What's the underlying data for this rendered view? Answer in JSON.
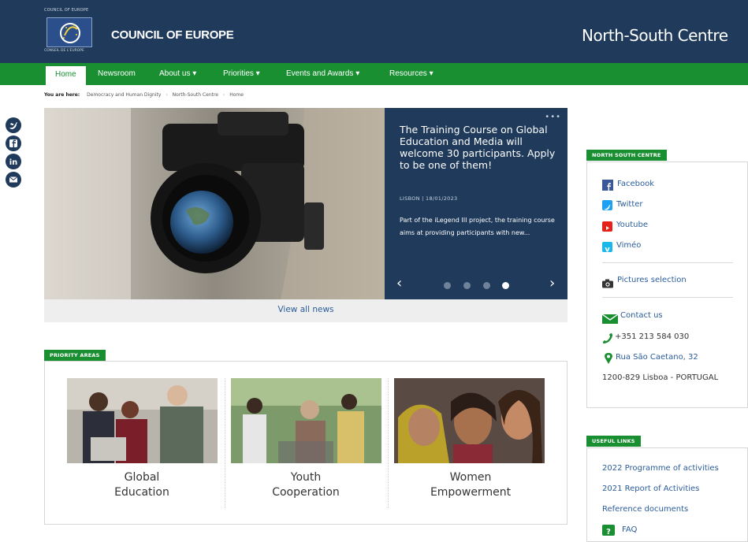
{
  "header": {
    "logo_top_text": "COUNCIL OF EUROPE",
    "logo_bottom_text": "CONSEIL DE L'EUROPE",
    "site_name": "COUNCIL OF EUROPE",
    "section_title": "North-South Centre"
  },
  "nav": {
    "items": [
      {
        "label": "Home"
      },
      {
        "label": "Newsroom"
      },
      {
        "label": "About us ▾"
      },
      {
        "label": "Priorities ▾"
      },
      {
        "label": "Events and Awards ▾"
      },
      {
        "label": "Resources ▾"
      }
    ]
  },
  "breadcrumb": {
    "label": "You are here:",
    "items": [
      "Democracy and Human Dignity",
      "North-South Centre",
      "Home"
    ]
  },
  "share": {
    "icons": [
      "twitter-icon",
      "facebook-icon",
      "linkedin-icon",
      "email-icon"
    ]
  },
  "hero": {
    "title": "The Training Course on Global Education and Media will welcome 30 participants. Apply to be one of them!",
    "meta": "LISBON | 18/01/2023",
    "description": "Part of the iLegend III project, the training course aims at providing participants with new...",
    "more_icon": "•••",
    "prev": "‹",
    "next": "›",
    "slides": 4,
    "active_slide": 4,
    "view_all": "View all news"
  },
  "priority": {
    "tag": "PRIORITY AREAS",
    "areas": [
      {
        "line1": "Global",
        "line2": "Education"
      },
      {
        "line1": "Youth",
        "line2": "Cooperation"
      },
      {
        "line1": "Women",
        "line2": "Empowerment"
      }
    ]
  },
  "sidebar": {
    "nsc_tag": "NORTH SOUTH CENTRE",
    "social": [
      "Facebook",
      "Twitter",
      "Youtube",
      "Viméo"
    ],
    "pictures": "Pictures selection",
    "contact": "Contact us",
    "phone": "+351 213 584 030",
    "street": "Rua São Caetano, 32",
    "city": "1200-829 Lisboa - PORTUGAL",
    "links_tag": "USEFUL LINKS",
    "links": [
      "2022 Programme of activities",
      "2021 Report of Activities",
      "Reference documents",
      "FAQ"
    ]
  },
  "colors": {
    "header_bg": "#1f3a5a",
    "nav_green": "#198f32",
    "link_blue": "#2a5c9a"
  }
}
